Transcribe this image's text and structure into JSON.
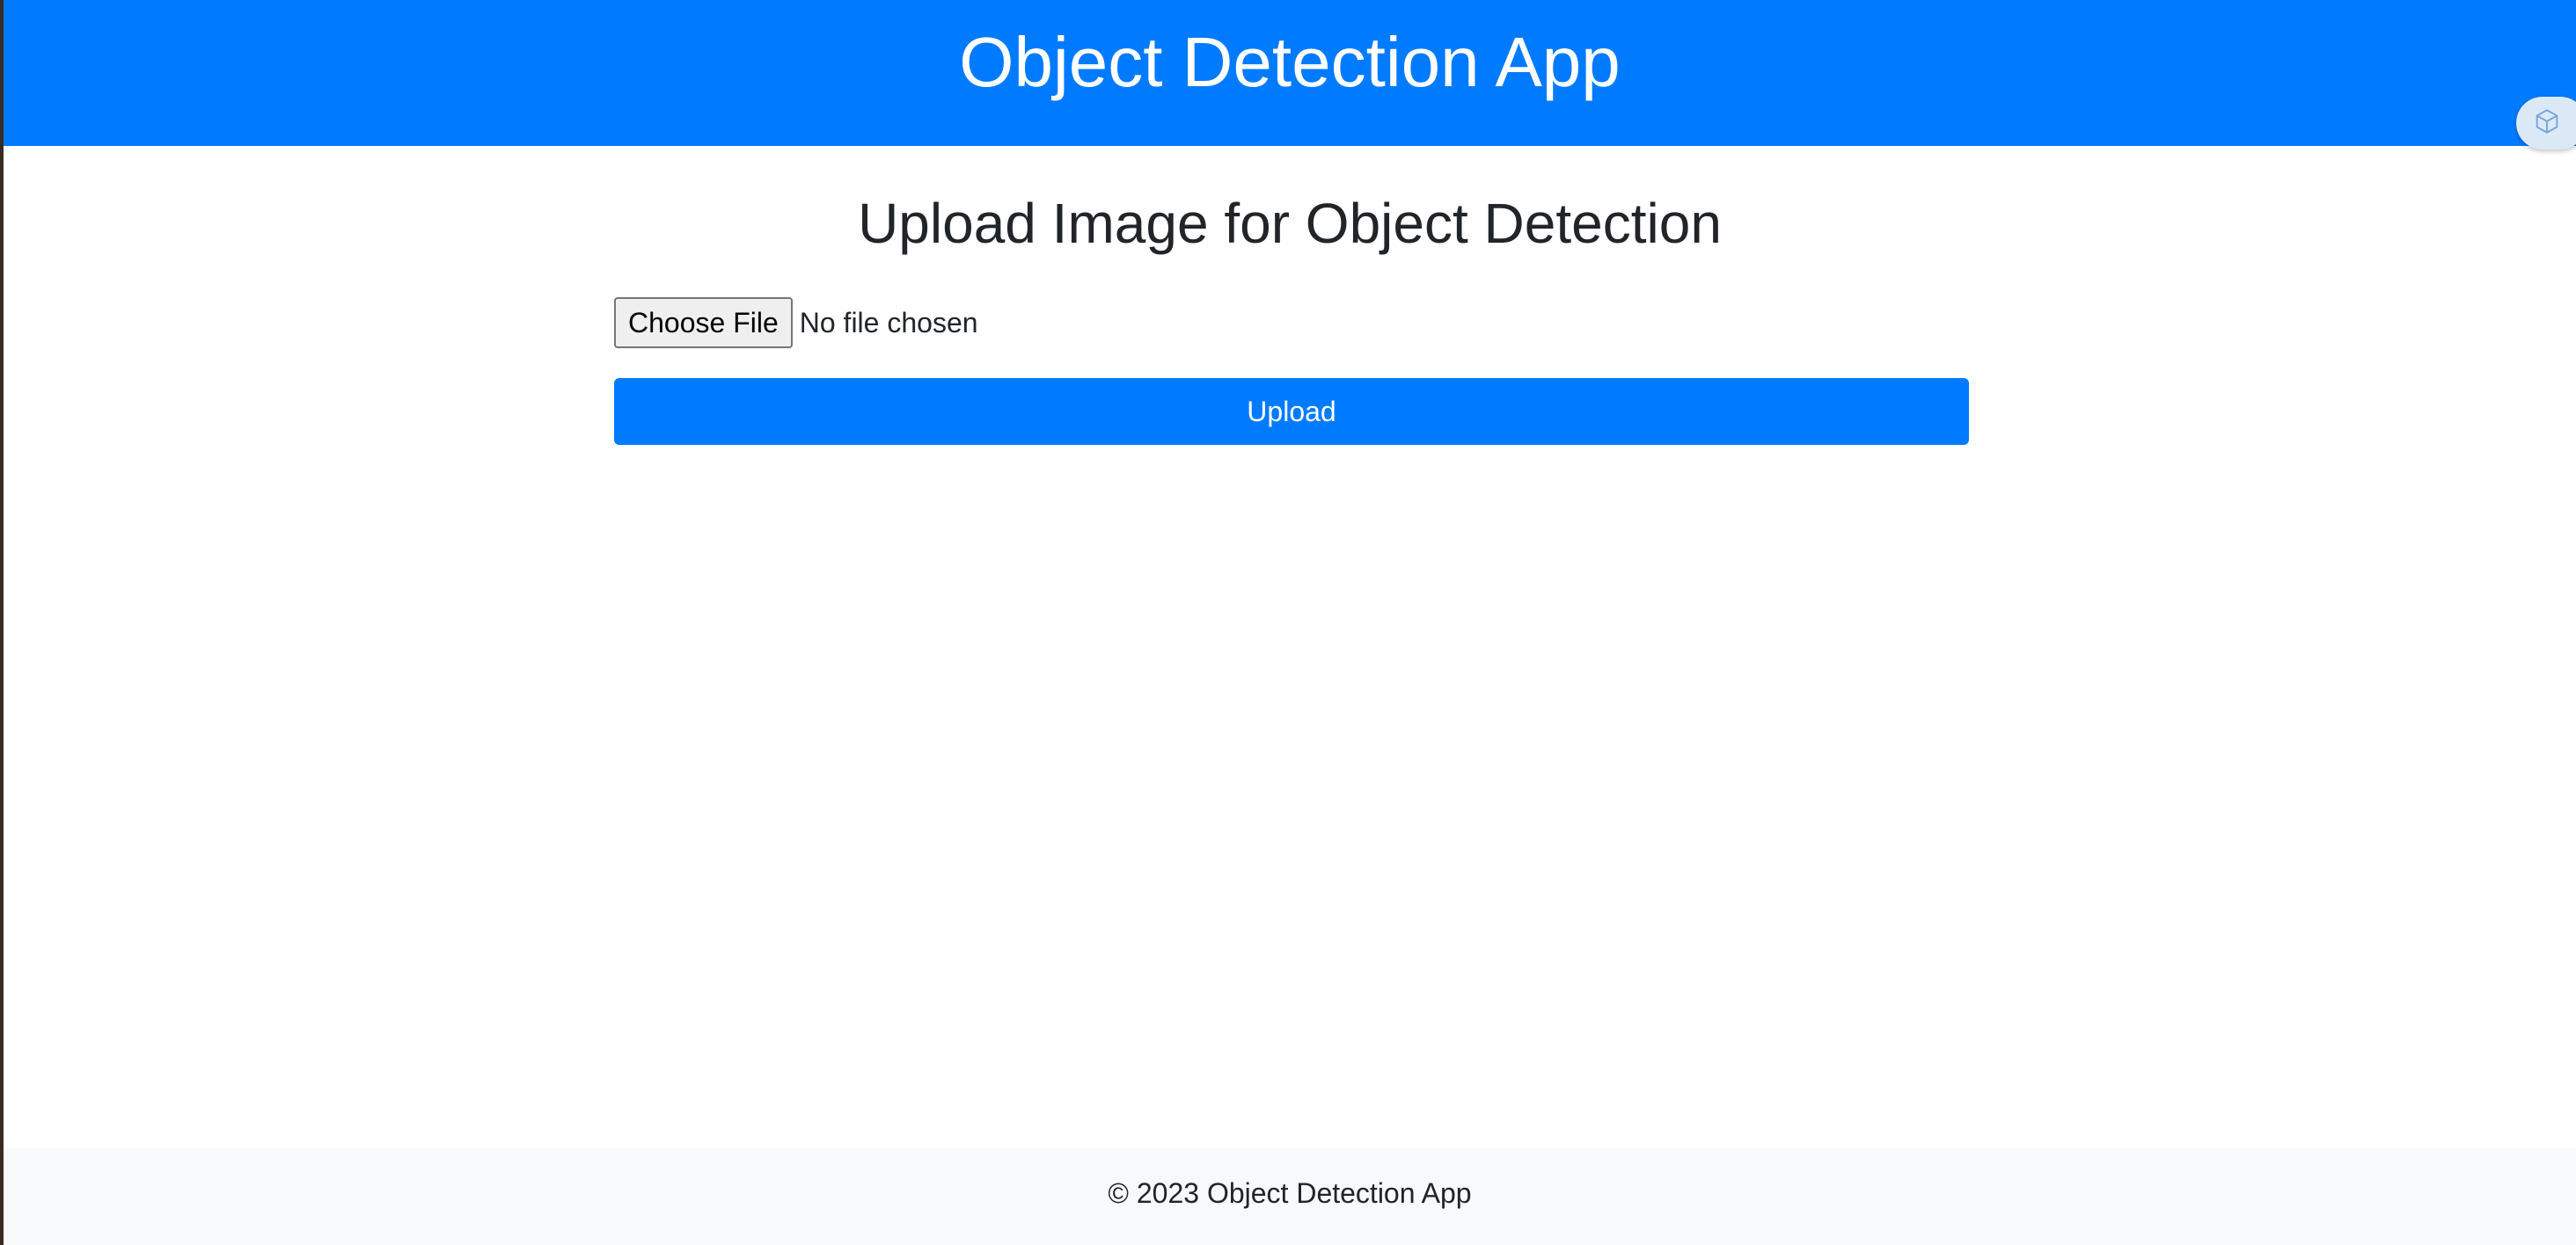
{
  "header": {
    "title": "Object Detection App"
  },
  "main": {
    "heading": "Upload Image for Object Detection",
    "file_input": {
      "button_label": "Choose File",
      "status": "No file chosen"
    },
    "upload_label": "Upload"
  },
  "footer": {
    "text": "© 2023 Object Detection App"
  },
  "overlay": {
    "icon": "extension-cube-icon"
  },
  "colors": {
    "primary": "#007bff",
    "footer_bg": "#f8f9fa",
    "text": "#212529"
  }
}
